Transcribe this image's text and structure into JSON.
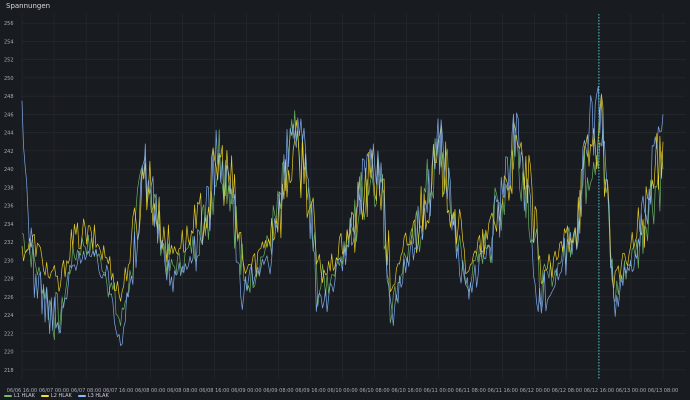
{
  "panel": {
    "title": "Spannungen"
  },
  "colors": {
    "background": "#181b1f",
    "grid": "#2c3036",
    "tick_text": "#a8abb3",
    "crosshair": "#4cc4d4"
  },
  "chart_data": {
    "type": "line",
    "title": "Spannungen",
    "xlabel": "",
    "ylabel": "",
    "ylim": [
      217,
      257
    ],
    "yticks": [
      218,
      220,
      222,
      224,
      226,
      228,
      230,
      232,
      234,
      236,
      238,
      240,
      242,
      244,
      246,
      248,
      250,
      252,
      254,
      256
    ],
    "x_tick_labels": [
      "06/06 16:00",
      "06/07 00:00",
      "06/07 08:00",
      "06/07 16:00",
      "06/08 00:00",
      "06/08 08:00",
      "06/08 16:00",
      "06/09 00:00",
      "06/09 08:00",
      "06/09 16:00",
      "06/10 00:00",
      "06/10 08:00",
      "06/10 16:00",
      "06/11 00:00",
      "06/11 08:00",
      "06/11 16:00",
      "06/12 00:00",
      "06/12 08:00",
      "06/12 16:00",
      "06/13 00:00",
      "06/13 08:00"
    ],
    "crosshair_at": "06/12 16:00",
    "grid": true,
    "legend_position": "bottom-left",
    "series": [
      {
        "name": "L1 HLAK",
        "color": "#73bf69",
        "values": [
          233,
          230,
          226,
          223,
          230,
          232,
          231,
          228,
          223,
          230,
          241,
          234,
          229,
          230,
          232,
          235,
          242,
          238,
          227,
          229,
          232,
          236,
          243,
          239,
          227,
          228,
          231,
          234,
          239,
          240,
          225,
          230,
          233,
          238,
          242,
          235,
          227,
          230,
          233,
          237,
          243,
          238,
          227,
          228,
          231,
          235,
          241,
          244,
          226,
          229,
          232,
          237,
          240
        ]
      },
      {
        "name": "L2 HLAK",
        "color": "#fade2a",
        "values": [
          231,
          232,
          229,
          227,
          232,
          233,
          232,
          230,
          226,
          232,
          240,
          235,
          231,
          232,
          233,
          236,
          241,
          238,
          229,
          230,
          233,
          236,
          242,
          240,
          229,
          229,
          232,
          234,
          238,
          240,
          227,
          231,
          234,
          238,
          241,
          236,
          229,
          231,
          233,
          237,
          242,
          239,
          229,
          229,
          232,
          235,
          242,
          245,
          228,
          230,
          233,
          237,
          243
        ]
      },
      {
        "name": "L3 HLAK",
        "color": "#8ab8ff",
        "values": [
          244,
          228,
          225,
          222,
          229,
          231,
          230,
          228,
          222,
          228,
          242,
          233,
          228,
          229,
          231,
          235,
          243,
          237,
          226,
          228,
          231,
          236,
          245,
          240,
          226,
          227,
          230,
          234,
          240,
          241,
          224,
          229,
          232,
          238,
          244,
          234,
          226,
          229,
          232,
          238,
          245,
          237,
          226,
          227,
          230,
          235,
          244,
          248,
          225,
          228,
          231,
          238,
          246
        ]
      }
    ]
  }
}
